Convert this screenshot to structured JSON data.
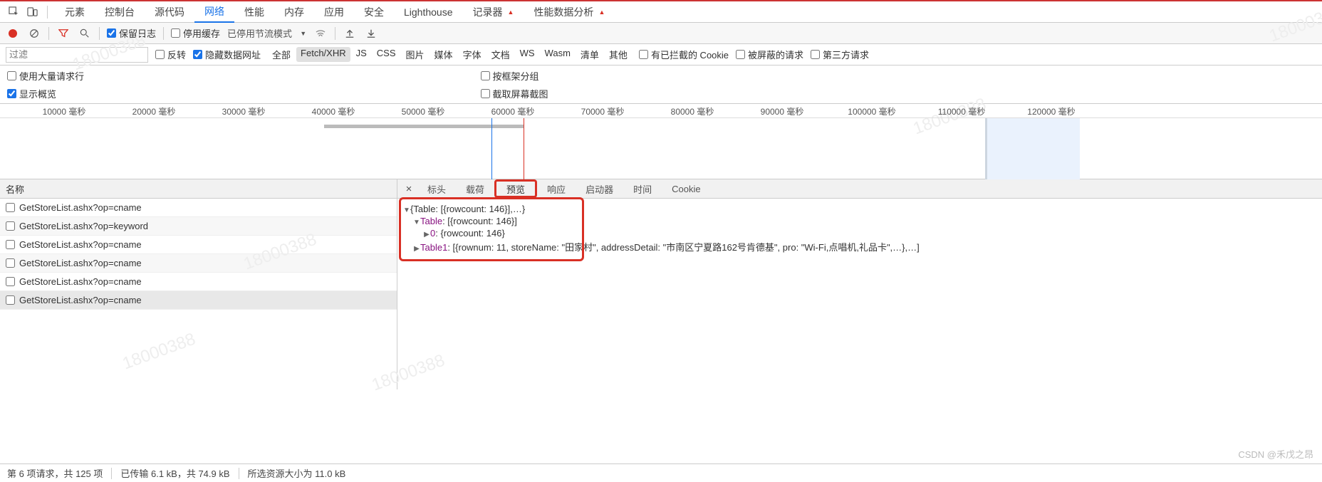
{
  "topbar": {
    "tabs": [
      "元素",
      "控制台",
      "源代码",
      "网络",
      "性能",
      "内存",
      "应用",
      "安全",
      "Lighthouse",
      "记录器",
      "性能数据分析"
    ],
    "activeTabIndex": 3,
    "betaTabs": [
      9,
      10
    ]
  },
  "toolbar": {
    "preserveLog": "保留日志",
    "disableCache": "停用缓存",
    "throttleLabel": "已停用节流模式"
  },
  "filter": {
    "placeholder": "过滤",
    "invert": "反转",
    "hideDataUrls": "隐藏数据网址",
    "types": [
      "全部",
      "Fetch/XHR",
      "JS",
      "CSS",
      "图片",
      "媒体",
      "字体",
      "文档",
      "WS",
      "Wasm",
      "清单",
      "其他"
    ],
    "activeTypeIndex": 1,
    "blockedCookies": "有已拦截的 Cookie",
    "blockedRequests": "被屏蔽的请求",
    "thirdParty": "第三方请求"
  },
  "options": {
    "useLargeRows": "使用大量请求行",
    "showOverview": "显示概览",
    "groupByFrame": "按框架分组",
    "captureScreenshots": "截取屏幕截图"
  },
  "timeline": {
    "ticks": [
      "10000 毫秒",
      "20000 毫秒",
      "30000 毫秒",
      "40000 毫秒",
      "50000 毫秒",
      "60000 毫秒",
      "70000 毫秒",
      "80000 毫秒",
      "90000 毫秒",
      "100000 毫秒",
      "110000 毫秒",
      "120000 毫秒"
    ]
  },
  "leftPane": {
    "header": "名称",
    "requests": [
      "GetStoreList.ashx?op=cname",
      "GetStoreList.ashx?op=keyword",
      "GetStoreList.ashx?op=cname",
      "GetStoreList.ashx?op=cname",
      "GetStoreList.ashx?op=cname",
      "GetStoreList.ashx?op=cname"
    ],
    "selectedIndex": 5
  },
  "rightPane": {
    "tabs": [
      "标头",
      "载荷",
      "预览",
      "响应",
      "启动器",
      "时间",
      "Cookie"
    ],
    "activeTabIndex": 2,
    "preview": {
      "root": "{Table: [{rowcount: 146}],…}",
      "tableKey": "Table",
      "tableVal": ": [{rowcount: 146}]",
      "zeroKey": "0",
      "zeroVal": ": {rowcount: 146}",
      "table1Key": "Table1",
      "table1Val": ": [{rownum: 11, storeName: \"田家村\", addressDetail: \"市南区宁夏路162号肯德基\", pro: \"Wi-Fi,点唱机,礼品卡\",…},…]"
    }
  },
  "statusBar": {
    "seg1": "第 6 项请求，共 125 项",
    "seg2": "已传输 6.1 kB，共 74.9 kB",
    "seg3": "所选资源大小为 11.0 kB"
  },
  "watermark": "CSDN @禾戊之昂",
  "wmDiag": "18000388"
}
